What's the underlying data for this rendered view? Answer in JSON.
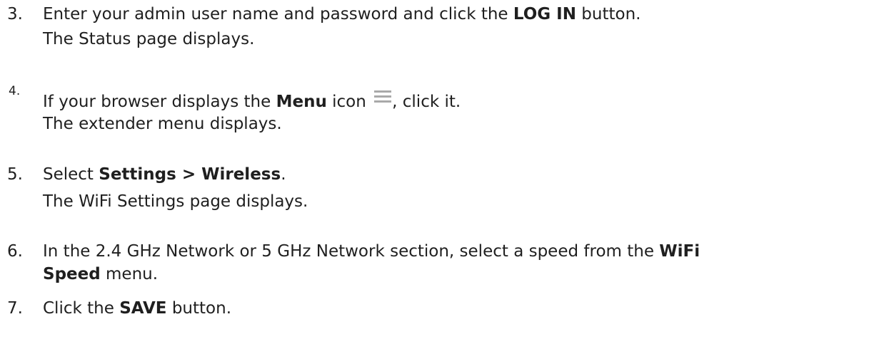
{
  "steps": [
    {
      "number": "3.",
      "line1": {
        "pre": "Enter your admin user name and password and click the ",
        "bold": "LOG IN",
        "post": " button."
      },
      "result": "The Status page displays."
    },
    {
      "number": "4.",
      "line1": {
        "pre": "If your browser displays the ",
        "bold": "Menu",
        "mid": " icon ",
        "icon": "menu-icon",
        "post": ", click it."
      },
      "result": "The extender menu displays."
    },
    {
      "number": "5.",
      "line1": {
        "pre": "Select ",
        "bold": "Settings > Wireless",
        "post": "."
      },
      "result": "The WiFi Settings page displays."
    },
    {
      "number": "6.",
      "line1": {
        "pre": "In the 2.4 GHz Network or 5 GHz Network section, select a speed from the ",
        "bold": "WiFi"
      },
      "line2": {
        "bold": "Speed",
        "post": " menu."
      }
    },
    {
      "number": "7.",
      "line1": {
        "pre": "Click the ",
        "bold": "SAVE",
        "post": " button."
      }
    }
  ],
  "colors": {
    "text": "#1f1f1f",
    "menu_icon": "#a9a9a9"
  }
}
